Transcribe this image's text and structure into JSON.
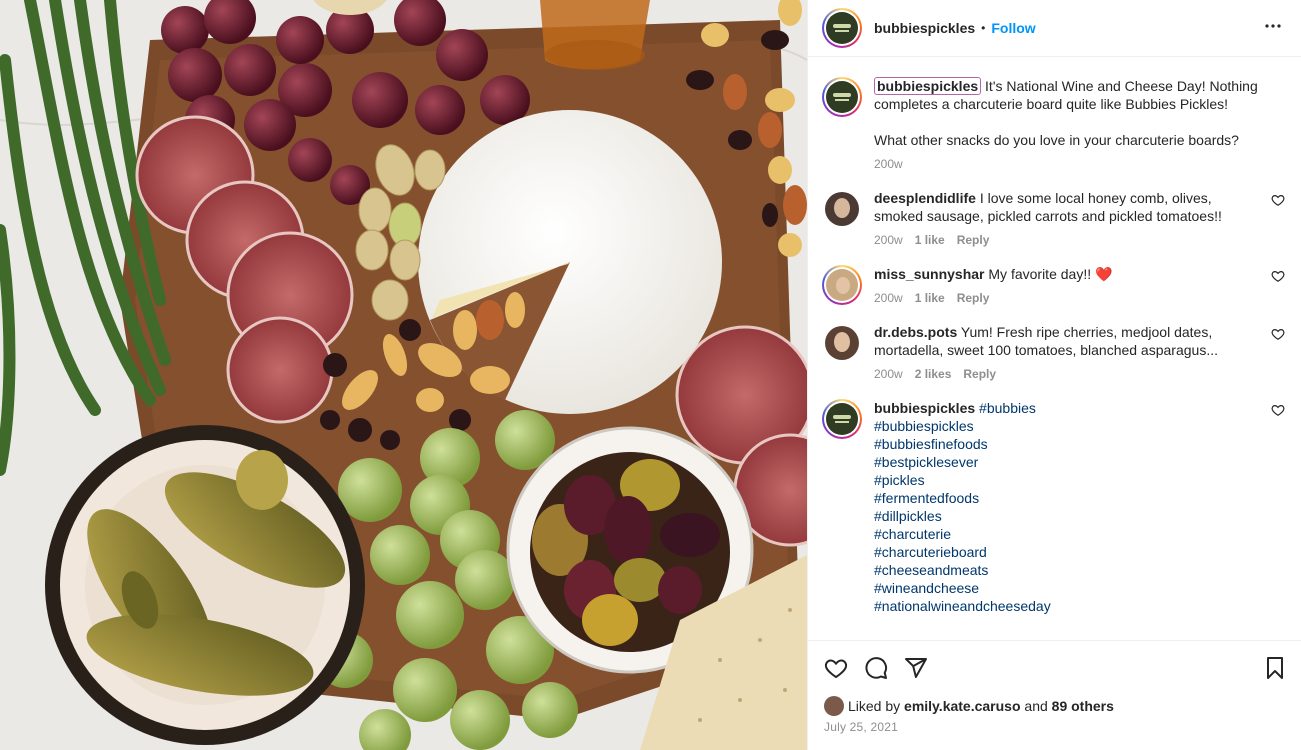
{
  "post": {
    "author": "bubbiespickles",
    "follow_label": "Follow",
    "separator": "•",
    "more_label": "•••"
  },
  "caption": {
    "author": "bubbiespickles",
    "text_1": "It's National Wine and Cheese Day! Nothing completes a charcuterie board quite like Bubbies Pickles!",
    "text_2": "What other snacks do you love in your charcuterie boards?",
    "time": "200w"
  },
  "comments": [
    {
      "user": "deesplendidlife",
      "text": "I love some local honey comb, olives, smoked sausage, pickled carrots and pickled tomatoes!!",
      "time": "200w",
      "likes": "1 like",
      "reply": "Reply"
    },
    {
      "user": "miss_sunnyshar",
      "text": "My favorite day!! ❤️",
      "time": "200w",
      "likes": "1 like",
      "reply": "Reply"
    },
    {
      "user": "dr.debs.pots",
      "text": "Yum! Fresh ripe cherries, medjool dates, mortadella, sweet 100 tomatoes, blanched asparagus...",
      "time": "200w",
      "likes": "2 likes",
      "reply": "Reply"
    }
  ],
  "hashtag_comment": {
    "user": "bubbiespickles",
    "first_tag": "#bubbies",
    "tags": [
      "#bubbiespickles",
      "#bubbiesfinefoods",
      "#bestpicklesever",
      "#pickles",
      "#fermentedfoods",
      "#dillpickles",
      "#charcuterie",
      "#charcuterieboard",
      "#cheeseandmeats",
      "#wineandcheese",
      "#nationalwineandcheeseday"
    ]
  },
  "likes": {
    "prefix": "Liked by",
    "user": "emily.kate.caruso",
    "and": "and",
    "others": "89 others"
  },
  "date": "July 25, 2021",
  "icons": {
    "like": "heart-icon",
    "comment": "comment-icon",
    "share": "share-icon",
    "save": "bookmark-icon",
    "comment_like": "heart-icon"
  },
  "colors": {
    "accent": "#0095f6",
    "hashtag": "#00376b",
    "muted": "#8e8e8e"
  }
}
